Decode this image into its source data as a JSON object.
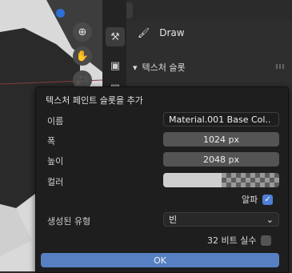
{
  "header": {
    "editor_type_icon": "properties-editor-icon"
  },
  "tool": {
    "label": "Draw",
    "icon": "brush-icon"
  },
  "panel": {
    "title": "텍스처 슬롯"
  },
  "dialog": {
    "title": "텍스처 페인트 슬롯을 추가",
    "name_label": "이름",
    "name_value": "Material.001 Base Col..",
    "width_label": "폭",
    "width_value": "1024 px",
    "height_label": "높이",
    "height_value": "2048 px",
    "color_label": "컬러",
    "alpha_label": "알파",
    "alpha_checked": true,
    "generated_type_label": "생성된 유형",
    "generated_type_value": "빈",
    "float_label": "32 비트 실수",
    "float_checked": false,
    "ok_label": "OK"
  },
  "colors": {
    "accent": "#4f7fd6",
    "ok_button": "#5680c2",
    "gizmo_dot": "#2f6fd6"
  }
}
